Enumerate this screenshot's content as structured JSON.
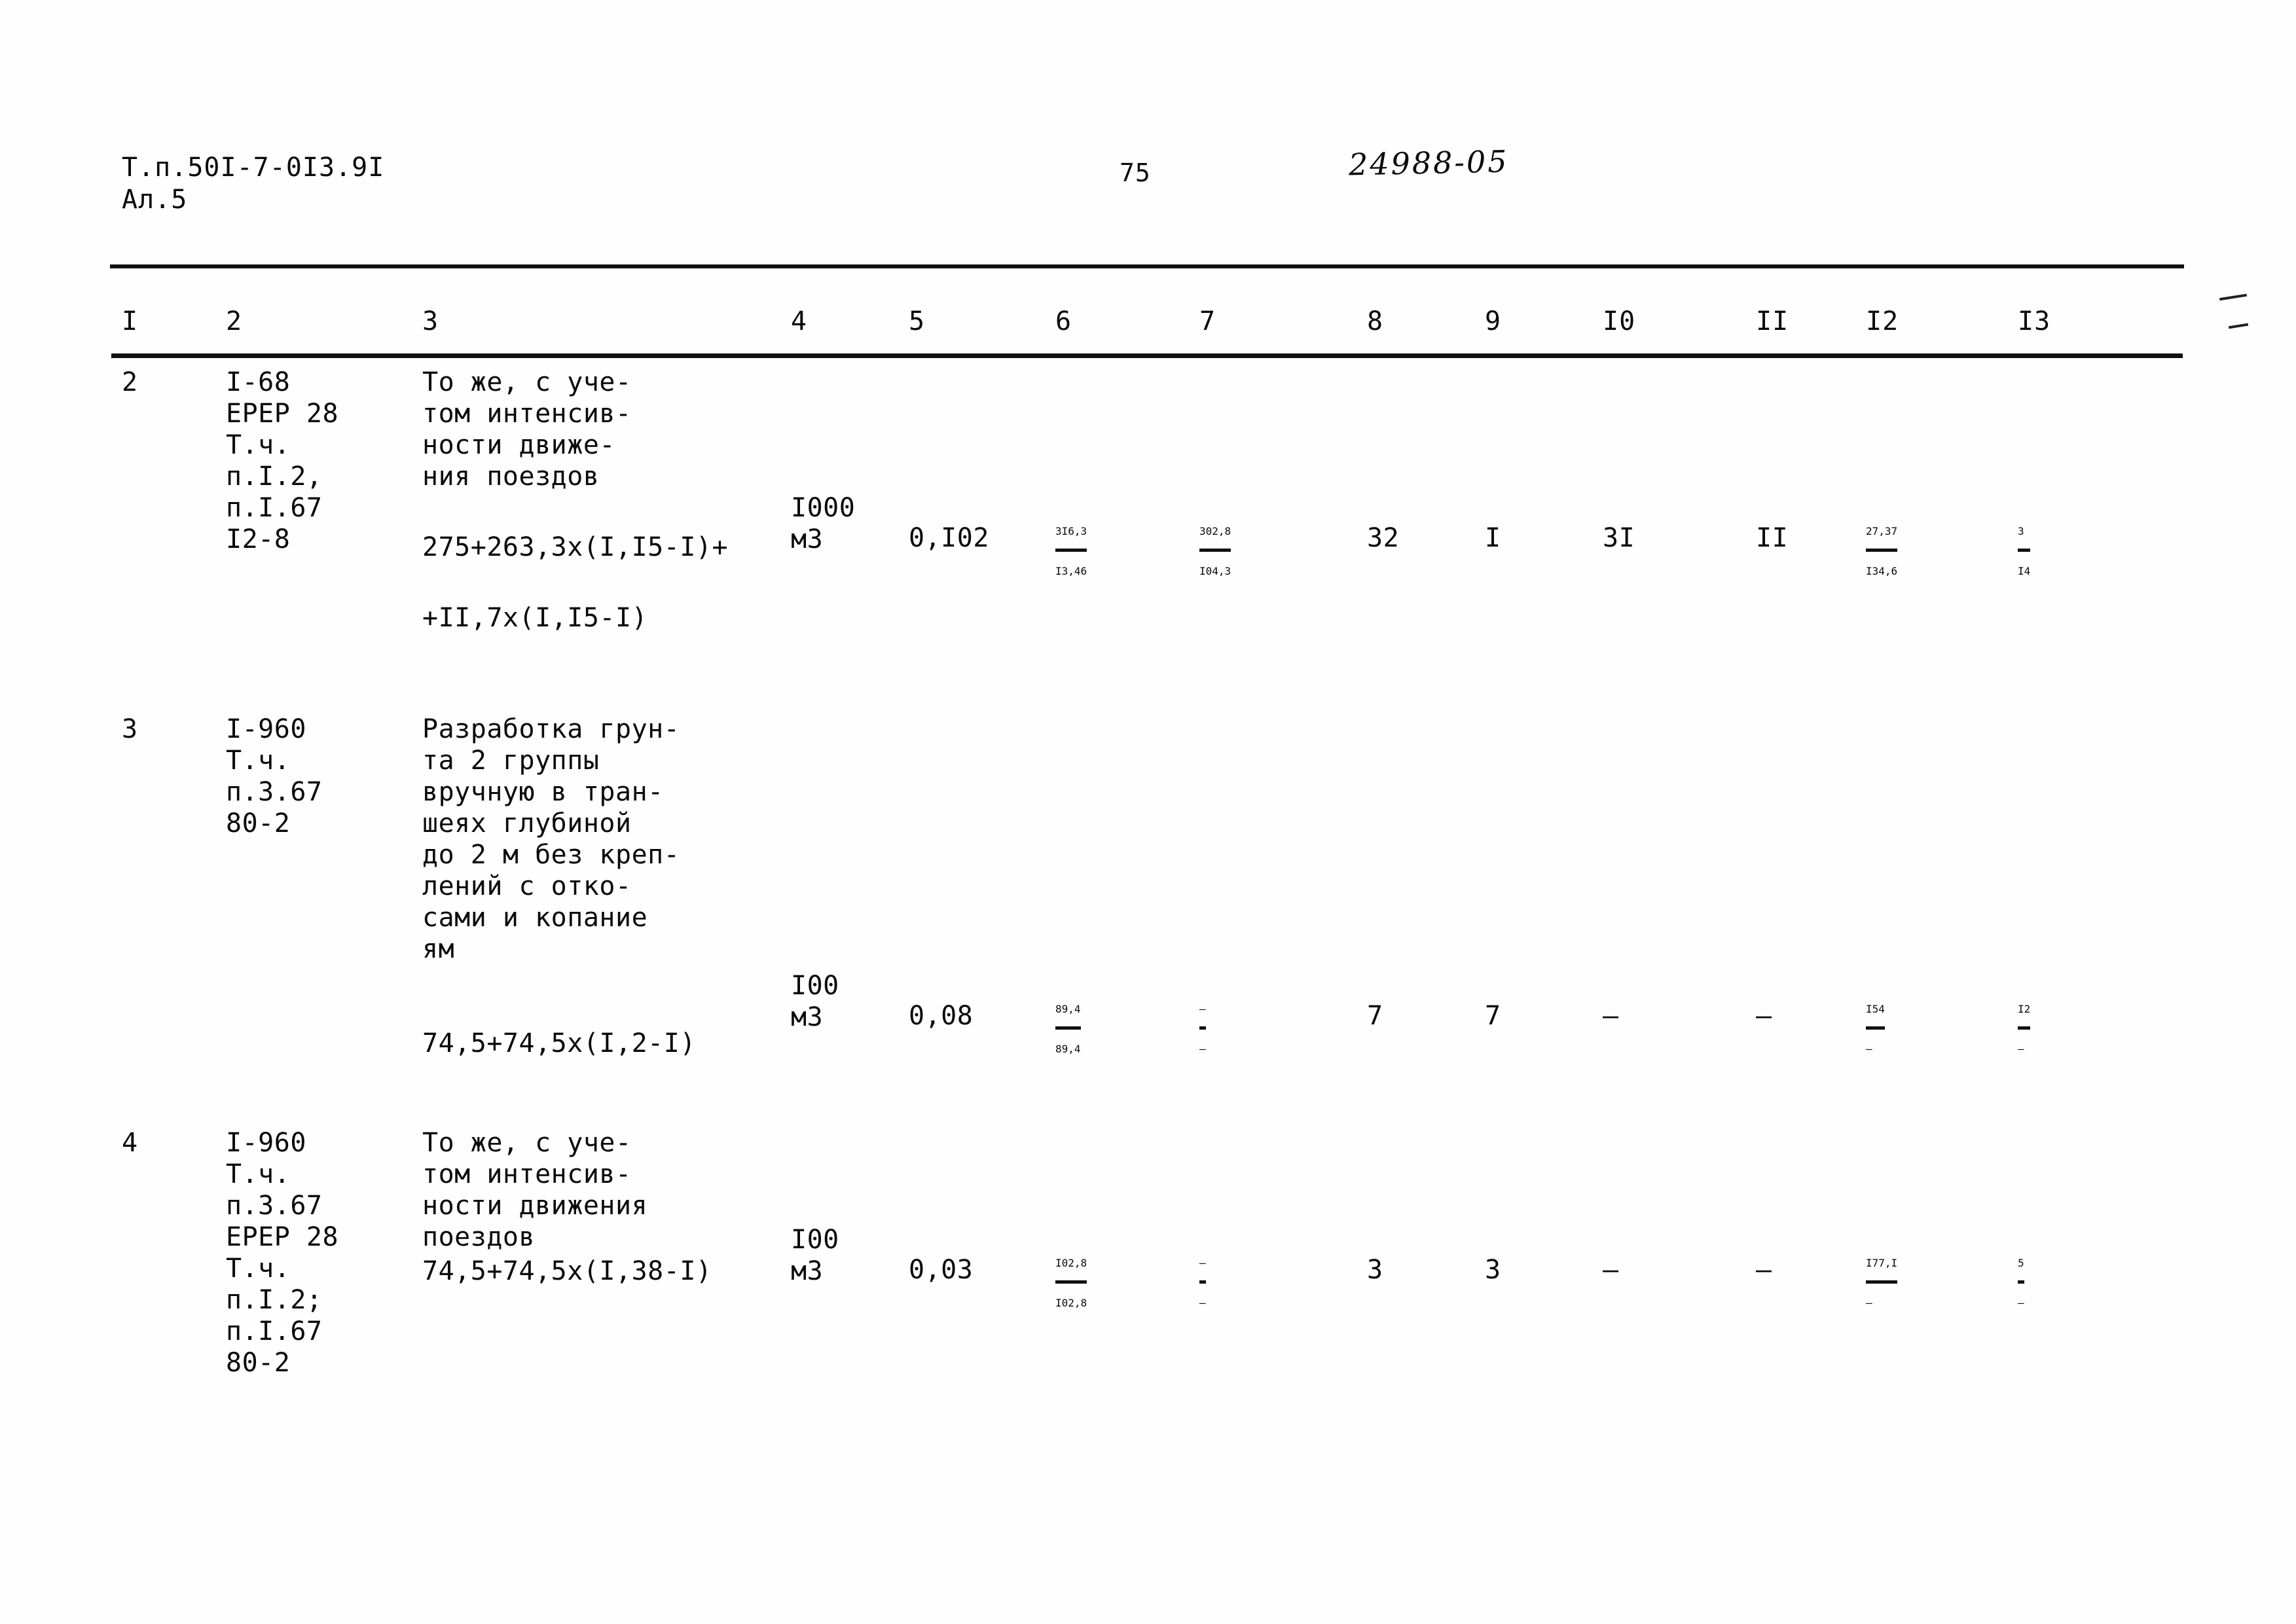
{
  "header": {
    "doc_code_line1": "Т.п.50I-7-0I3.9I",
    "doc_code_line2": "Ал.5",
    "page_number": "75",
    "stamp": "24988-05"
  },
  "table": {
    "column_headers": [
      "I",
      "2",
      "3",
      "4",
      "5",
      "6",
      "7",
      "8",
      "9",
      "I0",
      "II",
      "I2",
      "I3"
    ],
    "rows": [
      {
        "num": "2",
        "code": "I-68\nЕРЕР 28\nТ.ч.\nп.I.2,\nп.I.67\nI2-8",
        "description": "То же, с уче-\nтом интенсив-\nности движе-\nния поездов",
        "formula1": "275+263,3х(I,I5-I)+",
        "formula2": "+II,7х(I,I5-I)",
        "unit": "I000\nм3",
        "c5": "0,I02",
        "c6_top": "3I6,3",
        "c6_bot": "I3,46",
        "c7_top": "302,8",
        "c7_bot": "I04,3",
        "c8": "32",
        "c9": "I",
        "c10": "3I",
        "c11": "II",
        "c12_top": "27,37",
        "c12_bot": "I34,6",
        "c13_top": "3",
        "c13_bot": "I4"
      },
      {
        "num": "3",
        "code": "I-960\nТ.ч.\nп.3.67\n80-2",
        "description": "Разработка грун-\nта 2 группы\nвручную в тран-\nшеях глубиной\nдо 2 м без креп-\nлений с отко-\nсами и копание\nям",
        "formula1": "74,5+74,5х(I,2-I)",
        "formula2": "",
        "unit": "I00\nм3",
        "c5": "0,08",
        "c6_top": "89,4",
        "c6_bot": "89,4",
        "c7_top": "—",
        "c7_bot": "—",
        "c8": "7",
        "c9": "7",
        "c10": "—",
        "c11": "—",
        "c12_top": "I54",
        "c12_bot": "—",
        "c13_top": "I2",
        "c13_bot": "—"
      },
      {
        "num": "4",
        "code": "I-960\nТ.ч.\nп.3.67\nЕРЕР 28\nТ.ч.\nп.I.2;\nп.I.67\n80-2",
        "description": "То же, с уче-\nтом интенсив-\nности движения\nпоездов",
        "formula1": "74,5+74,5х(I,38-I)",
        "formula2": "",
        "unit": "I00\nм3",
        "c5": "0,03",
        "c6_top": "I02,8",
        "c6_bot": "I02,8",
        "c7_top": "—",
        "c7_bot": "—",
        "c8": "3",
        "c9": "3",
        "c10": "—",
        "c11": "—",
        "c12_top": "I77,I",
        "c12_bot": "—",
        "c13_top": "5",
        "c13_bot": "—"
      }
    ]
  }
}
